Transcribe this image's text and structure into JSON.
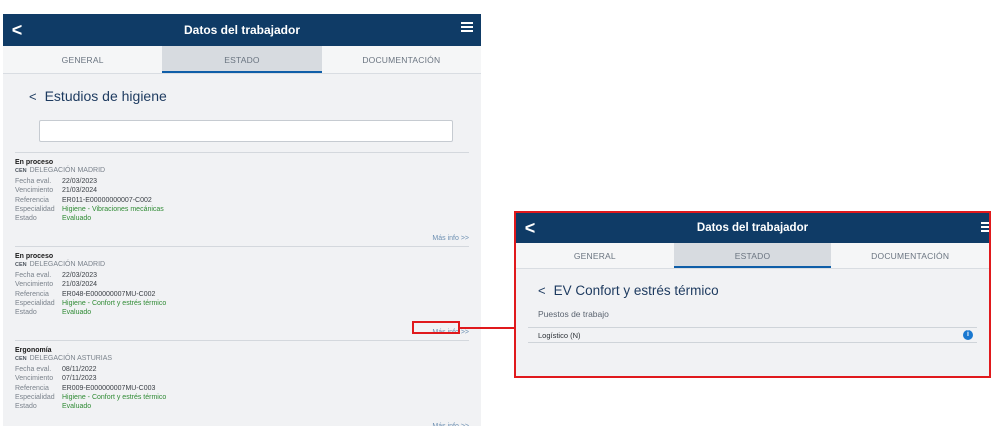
{
  "left_panel": {
    "header": {
      "title": "Datos del trabajador",
      "back_glyph": "<",
      "menu_icon": "hamburger-icon"
    },
    "tabs": [
      {
        "label": "GENERAL",
        "active": false
      },
      {
        "label": "ESTADO",
        "active": true
      },
      {
        "label": "DOCUMENTACIÓN",
        "active": false
      }
    ],
    "section": {
      "chevron": "<",
      "title": "Estudios de higiene"
    },
    "search": {
      "placeholder": "",
      "value": ""
    },
    "labels": {
      "fecha": "Fecha eval.",
      "vencimiento": "Vencimiento",
      "referencia": "Referencia",
      "especialidad": "Especialidad",
      "estado": "Estado",
      "cen": "CEN",
      "mas_info": "Más info >>"
    },
    "cards": [
      {
        "status": "En proceso",
        "delegacion": "DELEGACIÓN MADRID",
        "fecha": "22/03/2023",
        "vencimiento": "21/03/2024",
        "referencia": "ER011-E00000000007-C002",
        "especialidad": "Higiene - Vibraciones mecánicas",
        "estado": "Evaluado"
      },
      {
        "status": "En proceso",
        "delegacion": "DELEGACIÓN MADRID",
        "fecha": "22/03/2023",
        "vencimiento": "21/03/2024",
        "referencia": "ER048-E000000007MU-C002",
        "especialidad": "Higiene - Confort y estrés térmico",
        "estado": "Evaluado"
      },
      {
        "status": "Ergonomía",
        "delegacion": "DELEGACIÓN ASTURIAS",
        "fecha": "08/11/2022",
        "vencimiento": "07/11/2023",
        "referencia": "ER009-E000000007MU-C003",
        "especialidad": "Higiene - Confort y estrés térmico",
        "estado": "Evaluado"
      }
    ]
  },
  "right_panel": {
    "header": {
      "title": "Datos del trabajador",
      "back_glyph": "<",
      "menu_icon": "hamburger-icon"
    },
    "tabs": [
      {
        "label": "GENERAL",
        "active": false
      },
      {
        "label": "ESTADO",
        "active": true
      },
      {
        "label": "DOCUMENTACIÓN",
        "active": false
      }
    ],
    "section": {
      "chevron": "<",
      "title": "EV Confort y estrés térmico"
    },
    "sub_label": "Puestos de trabajo",
    "items": [
      {
        "label": "Logístico (N)",
        "icon": "info-icon",
        "icon_glyph": "i"
      }
    ]
  },
  "colors": {
    "header_bg": "#0f3b66",
    "accent": "#0f5ea8",
    "highlight": "#e0191c",
    "green": "#2f8b34"
  }
}
